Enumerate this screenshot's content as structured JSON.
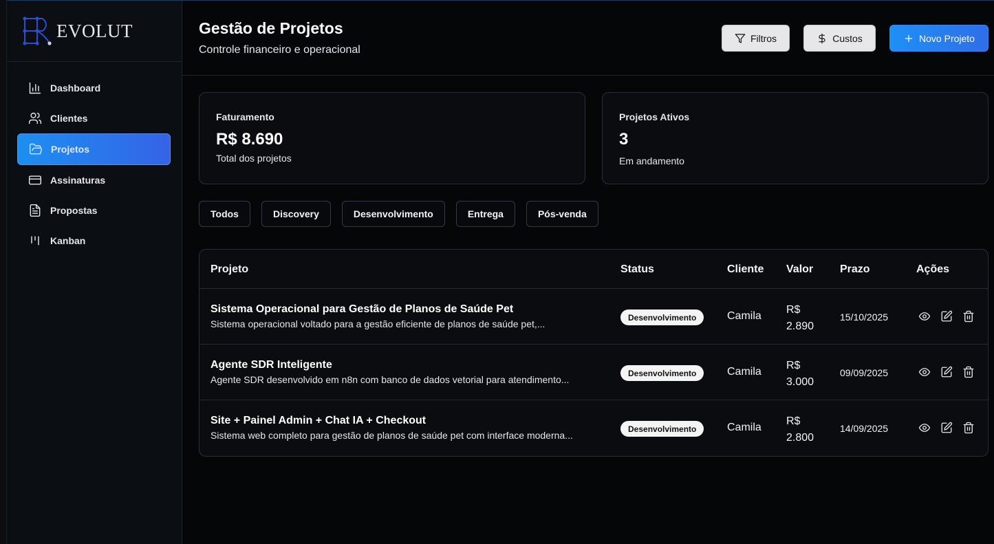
{
  "brand": {
    "name": "EVOLUT"
  },
  "sidebar": {
    "items": [
      {
        "label": "Dashboard",
        "icon": "bar-chart-icon"
      },
      {
        "label": "Clientes",
        "icon": "users-icon"
      },
      {
        "label": "Projetos",
        "icon": "folder-open-icon",
        "active": true
      },
      {
        "label": "Assinaturas",
        "icon": "credit-card-icon"
      },
      {
        "label": "Propostas",
        "icon": "file-text-icon"
      },
      {
        "label": "Kanban",
        "icon": "kanban-icon"
      }
    ]
  },
  "header": {
    "title": "Gestão de Projetos",
    "subtitle": "Controle financeiro e operacional",
    "filters_label": "Filtros",
    "costs_label": "Custos",
    "new_project_label": "Novo Projeto"
  },
  "stats": {
    "revenue": {
      "label": "Faturamento",
      "value": "R$ 8.690",
      "sub": "Total dos projetos"
    },
    "active": {
      "label": "Projetos Ativos",
      "value": "3",
      "sub": "Em andamento"
    }
  },
  "filter_tabs": [
    "Todos",
    "Discovery",
    "Desenvolvimento",
    "Entrega",
    "Pós-venda"
  ],
  "table": {
    "columns": [
      "Projeto",
      "Status",
      "Cliente",
      "Valor",
      "Prazo",
      "Ações"
    ],
    "rows": [
      {
        "name": "Sistema Operacional para Gestão de Planos de Saúde Pet",
        "desc": "Sistema operacional voltado para a gestão eficiente de planos de saúde pet,...",
        "status": "Desenvolvimento",
        "client": "Camila",
        "value_currency": "R$",
        "value_amount": "2.890",
        "deadline": "15/10/2025"
      },
      {
        "name": "Agente SDR Inteligente",
        "desc": "Agente SDR desenvolvido em n8n com banco de dados vetorial para atendimento...",
        "status": "Desenvolvimento",
        "client": "Camila",
        "value_currency": "R$",
        "value_amount": "3.000",
        "deadline": "09/09/2025"
      },
      {
        "name": "Site + Painel Admin + Chat IA + Checkout",
        "desc": "Sistema web completo para gestão de planos de saúde pet com interface moderna...",
        "status": "Desenvolvimento",
        "client": "Camila",
        "value_currency": "R$",
        "value_amount": "2.800",
        "deadline": "14/09/2025"
      }
    ]
  },
  "colors": {
    "accent": "#1e90f5",
    "accent_end": "#3563e6",
    "background": "#050608",
    "badge_bg": "#f4f4f5"
  }
}
